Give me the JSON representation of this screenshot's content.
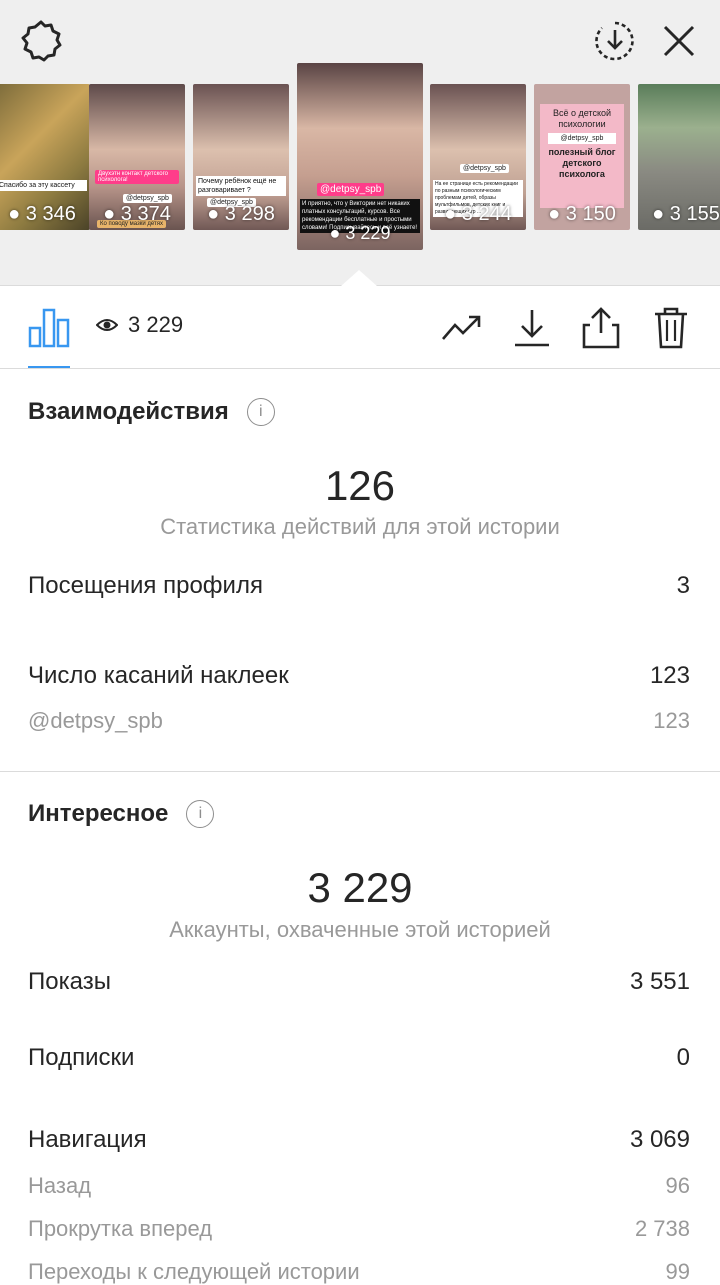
{
  "top": {
    "thumbnails": [
      {
        "views": "3 346",
        "caption": "Спасибо за эту кассету"
      },
      {
        "views": "3 374",
        "caption": "Двухэтн контакт детского психолога!",
        "tag": "@detpsy_spb",
        "extra": "Ко поводу мазки детях"
      },
      {
        "views": "3 298",
        "caption": "Почему ребёнок ещё не разговаривает ?",
        "tag": "@detpsy_spb"
      },
      {
        "views": "3 229",
        "caption": "И приятно, что у Виктории нет никаких платных консультаций, курсов. Все рекомендации бесплатные и простыми словами! Подписывайтесь и всё узнаете!",
        "tag": "@detpsy_spb"
      },
      {
        "views": "3 244",
        "caption": "На ее странице есть рекомендации по разным психологическим проблемам детей, образы мультфильмов, детских книг и развивающих игр ...",
        "tag": "@detpsy_spb"
      },
      {
        "views": "3 150",
        "caption": "Всё о детской психологии",
        "handle": "@detpsy_spb",
        "sub": "полезный блог детского психолога"
      },
      {
        "views": "3 155"
      }
    ]
  },
  "toolbar": {
    "views": "3 229"
  },
  "interactions": {
    "title": "Взаимодействия",
    "total": "126",
    "subtitle": "Статистика действий для этой истории",
    "rows": [
      {
        "label": "Посещения профиля",
        "value": "3"
      },
      {
        "label": "Число касаний наклеек",
        "value": "123"
      }
    ],
    "sub_rows": [
      {
        "label": "@detpsy_spb",
        "value": "123"
      }
    ]
  },
  "discovery": {
    "title": "Интересное",
    "total": "3 229",
    "subtitle": "Аккаунты, охваченные этой историей",
    "rows": [
      {
        "label": "Показы",
        "value": "3 551"
      },
      {
        "label": "Подписки",
        "value": "0"
      },
      {
        "label": "Навигация",
        "value": "3 069"
      }
    ],
    "sub_rows": [
      {
        "label": "Назад",
        "value": "96"
      },
      {
        "label": "Прокрутка вперед",
        "value": "2 738"
      },
      {
        "label": "Переходы к следующей истории",
        "value": "99"
      }
    ]
  },
  "colors": {
    "accent": "#3897f0",
    "muted": "#999999"
  }
}
